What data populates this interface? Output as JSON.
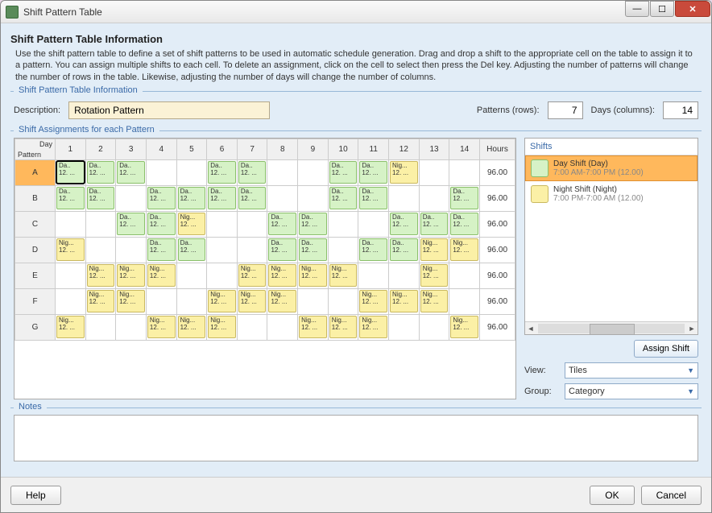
{
  "window": {
    "title": "Shift Pattern Table"
  },
  "heading": "Shift Pattern Table Information",
  "intro": "Use the shift pattern table to define a set of shift patterns to be used in automatic schedule generation. Drag and drop a shift to the appropriate cell on the table to assign it to a pattern. You can assign multiple shifts to each cell. To delete an assignment, click on the cell to select then press the Del key.  Adjusting the number of patterns will change the number of rows in the table. Likewise, adjusting the number of days will change the number of columns.",
  "section_info": {
    "legend": "Shift Pattern Table Information",
    "description_label": "Description:",
    "description_value": "Rotation Pattern",
    "patterns_label": "Patterns (rows):",
    "patterns_value": "7",
    "days_label": "Days (columns):",
    "days_value": "14"
  },
  "section_assign": {
    "legend": "Shift Assignments for each Pattern",
    "corner_day": "Day",
    "corner_pattern": "Pattern",
    "day_headers": [
      "1",
      "2",
      "3",
      "4",
      "5",
      "6",
      "7",
      "8",
      "9",
      "10",
      "11",
      "12",
      "13",
      "14"
    ],
    "hours_header": "Hours",
    "row_headers": [
      "A",
      "B",
      "C",
      "D",
      "E",
      "F",
      "G"
    ],
    "hours": [
      "96.00",
      "96.00",
      "96.00",
      "96.00",
      "96.00",
      "96.00",
      "96.00"
    ],
    "chip_day_l1": "Da..",
    "chip_day_l2": "12. ...",
    "chip_night_l1": "Nig...",
    "chip_night_l2": "12. ...",
    "grid": [
      [
        "D",
        "D",
        "D",
        "",
        "",
        "D",
        "D",
        "",
        "",
        "D",
        "D",
        "N",
        "",
        ""
      ],
      [
        "D",
        "D",
        "",
        "D",
        "D",
        "D",
        "D",
        "",
        "",
        "D",
        "D",
        "",
        "",
        "D"
      ],
      [
        "",
        "",
        "D",
        "D",
        "N",
        "",
        "",
        "D",
        "D",
        "",
        "",
        "D",
        "D",
        "D"
      ],
      [
        "N",
        "",
        "",
        "D",
        "D",
        "",
        "",
        "D",
        "D",
        "",
        "D",
        "D",
        "N",
        "N"
      ],
      [
        "",
        "N",
        "N",
        "N",
        "",
        "",
        "N",
        "N",
        "N",
        "N",
        "",
        "",
        "N",
        ""
      ],
      [
        "",
        "N",
        "N",
        "",
        "",
        "N",
        "N",
        "N",
        "",
        "",
        "N",
        "N",
        "N",
        ""
      ],
      [
        "N",
        "",
        "",
        "N",
        "N",
        "N",
        "",
        "",
        "N",
        "N",
        "N",
        "",
        "",
        "N"
      ]
    ],
    "active_row": 0,
    "selected_cell": [
      0,
      0
    ]
  },
  "shifts_panel": {
    "header": "Shifts",
    "items": [
      {
        "name": "Day Shift (Day)",
        "detail": "7:00 AM-7:00 PM (12.00)",
        "type": "day",
        "selected": true
      },
      {
        "name": "Night Shift (Night)",
        "detail": "7:00 PM-7:00 AM (12.00)",
        "type": "night",
        "selected": false
      }
    ],
    "assign_button": "Assign Shift",
    "view_label": "View:",
    "view_value": "Tiles",
    "group_label": "Group:",
    "group_value": "Category"
  },
  "notes": {
    "legend": "Notes",
    "value": ""
  },
  "footer": {
    "help": "Help",
    "ok": "OK",
    "cancel": "Cancel"
  }
}
